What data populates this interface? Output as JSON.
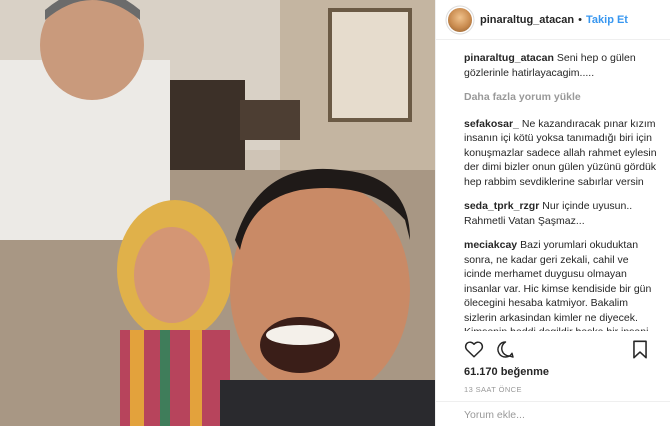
{
  "post": {
    "username": "pinaraltug_atacan",
    "follow_label": "Takip Et",
    "separator": "•"
  },
  "comments": [
    {
      "user": "pinaraltug_atacan",
      "text": "Seni hep o gülen gözlerinle hatirlayacagim....."
    },
    {
      "user": "sefakosar_",
      "text": "Ne kazandıracak pınar kızım insanın içi kötü yoksa tanımadığı biri için konuşmazlar sadece allah rahmet eylesin der dimi bizler onun gülen yüzünü gördük hep rabbim sevdiklerine sabırlar versin"
    },
    {
      "user": "seda_tprk_rzgr",
      "text": "Nur içinde uyusun.. Rahmetli Vatan Şaşmaz..."
    },
    {
      "user": "meciakcay",
      "text": "Bazi yorumlari okuduktan sonra, ne kadar geri zekali, cahil ve icinde merhamet duygusu olmayan insanlar var. Hic kimse kendiside bir gün ölecegini hesaba katmiyor. Bakalim sizlerin arkasindan kimler ne diyecek. Kimsenin haddi degildir baska bir insani yargilamak. Allahtan rahmet diliyorum. Cok yazik yazanlara"
    }
  ],
  "load_more": "Daha fazla yorum yükle",
  "likes": "61.170 beğenme",
  "timestamp": "13 SAAT ÖNCE",
  "add_comment_placeholder": "Yorum ekle...",
  "icons": [
    "heart-icon",
    "comment-icon",
    "bookmark-icon",
    "more-icon"
  ]
}
